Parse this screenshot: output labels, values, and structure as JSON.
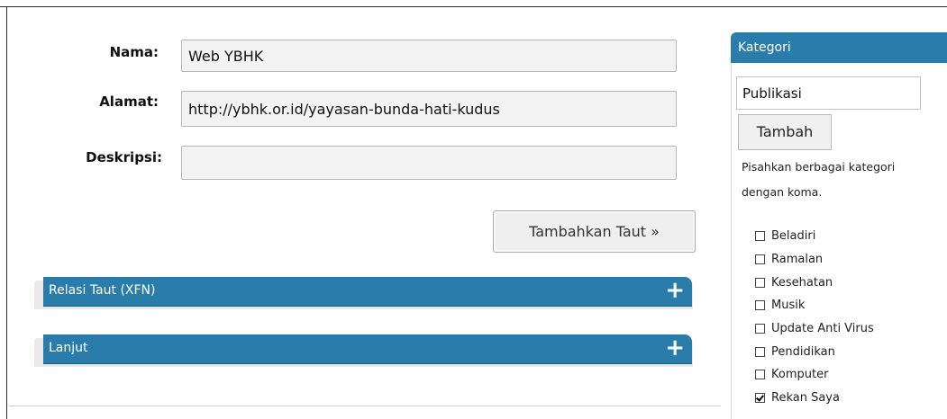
{
  "form": {
    "name_label": "Nama:",
    "name_value": "Web YBHK",
    "address_label": "Alamat:",
    "address_value": "http://ybhk.or.id/yayasan-bunda-hati-kudus",
    "description_label": "Deskripsi:",
    "description_value": "",
    "submit_label": "Tambahkan Taut »"
  },
  "panels": [
    {
      "title": "Relasi Taut (XFN)",
      "toggle": "+"
    },
    {
      "title": "Lanjut",
      "toggle": "+"
    }
  ],
  "category": {
    "header": "Kategori",
    "input_value": "Publikasi",
    "add_label": "Tambah",
    "hint_line1": "Pisahkan berbagai kategori",
    "hint_line2": "dengan koma.",
    "items": [
      {
        "label": "Beladiri",
        "checked": false
      },
      {
        "label": "Ramalan",
        "checked": false
      },
      {
        "label": "Kesehatan",
        "checked": false
      },
      {
        "label": "Musik",
        "checked": false
      },
      {
        "label": "Update Anti Virus",
        "checked": false
      },
      {
        "label": "Pendidikan",
        "checked": false
      },
      {
        "label": "Komputer",
        "checked": false
      },
      {
        "label": "Rekan Saya",
        "checked": true
      }
    ]
  },
  "colors": {
    "panel_blue": "#2a7cab",
    "field_background": "#f3f3f3"
  }
}
